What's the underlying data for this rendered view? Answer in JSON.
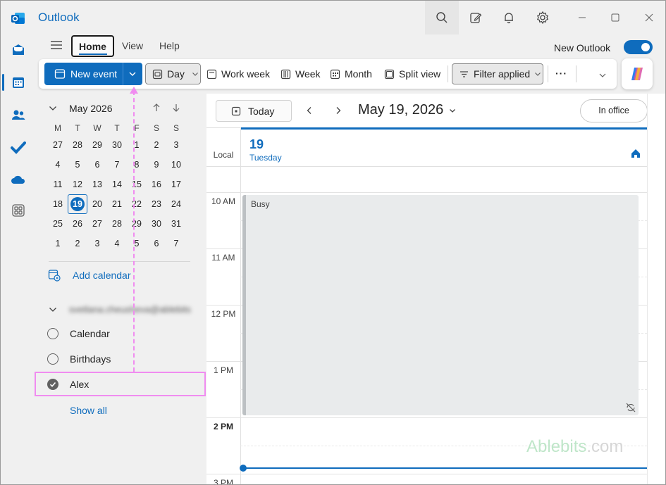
{
  "app": {
    "title": "Outlook"
  },
  "icons": {
    "logo": "outlook-logo-icon",
    "search": "search-icon",
    "compose": "compose-icon",
    "bell": "bell-icon",
    "gear": "gear-icon",
    "minimize": "minimize-icon",
    "maximize": "maximize-icon",
    "close": "close-icon"
  },
  "tabs": [
    {
      "label": "Home"
    },
    {
      "label": "View"
    },
    {
      "label": "Help"
    }
  ],
  "new_outlook": {
    "label": "New Outlook",
    "on": true
  },
  "ribbon": {
    "new_event": "New event",
    "day": "Day",
    "work_week": "Work week",
    "week": "Week",
    "month": "Month",
    "split_view": "Split view",
    "filter": "Filter applied",
    "more": "···"
  },
  "mini_calendar": {
    "month": "May 2026",
    "days_header": [
      "M",
      "T",
      "W",
      "T",
      "F",
      "S",
      "S"
    ],
    "weeks": [
      [
        "27",
        "28",
        "29",
        "30",
        "1",
        "2",
        "3"
      ],
      [
        "4",
        "5",
        "6",
        "7",
        "8",
        "9",
        "10"
      ],
      [
        "11",
        "12",
        "13",
        "14",
        "15",
        "16",
        "17"
      ],
      [
        "18",
        "19",
        "20",
        "21",
        "22",
        "23",
        "24"
      ],
      [
        "25",
        "26",
        "27",
        "28",
        "29",
        "30",
        "31"
      ],
      [
        "1",
        "2",
        "3",
        "4",
        "5",
        "6",
        "7"
      ]
    ],
    "selected": "19"
  },
  "sidebar": {
    "add_calendar": "Add calendar",
    "group_name": "svetlana.cheusheva@ablebits",
    "calendars": [
      {
        "label": "Calendar",
        "checked": false
      },
      {
        "label": "Birthdays",
        "checked": false
      },
      {
        "label": "Alex",
        "checked": true
      }
    ],
    "show_all": "Show all"
  },
  "calendar_header": {
    "today": "Today",
    "date": "May 19, 2026",
    "status": "In office"
  },
  "day_view": {
    "timezone": "Local",
    "day_num": "19",
    "day_name": "Tuesday",
    "times": [
      "10 AM",
      "11 AM",
      "12 PM",
      "1 PM",
      "2 PM",
      "3 PM"
    ],
    "event": "Busy"
  },
  "watermark": {
    "text": "Ablebits",
    "suffix": ".com"
  },
  "colors": {
    "accent": "#0f6cbd",
    "annotation": "#f08cf0",
    "event_bg": "#e9ebec"
  }
}
